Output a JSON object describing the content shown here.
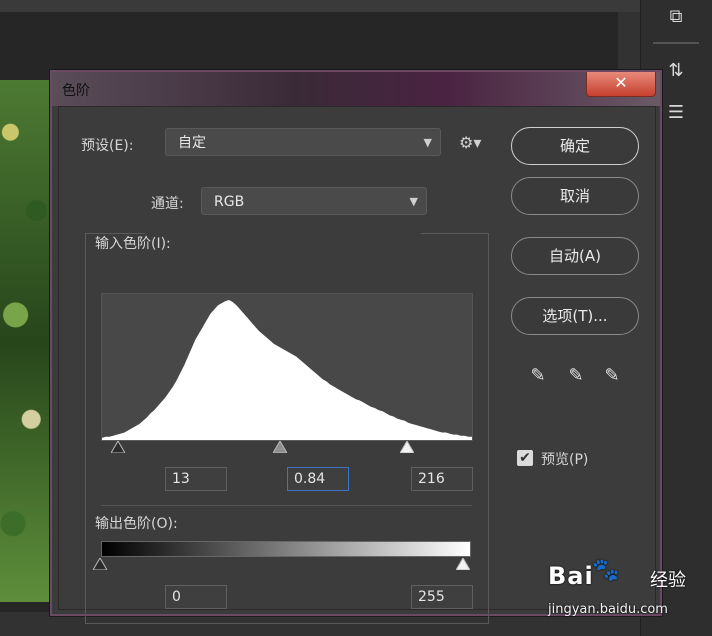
{
  "dialog": {
    "title": "色阶",
    "close_glyph": "✕"
  },
  "preset": {
    "label": "预设(E):",
    "value": "自定",
    "gear_icon": "gear-icon"
  },
  "channel": {
    "label": "通道:",
    "value": "RGB"
  },
  "input_levels": {
    "label": "输入色阶(I):",
    "black": "13",
    "gamma": "0.84",
    "white": "216"
  },
  "output_levels": {
    "label": "输出色阶(O):",
    "black": "0",
    "white": "255"
  },
  "buttons": {
    "ok": "确定",
    "cancel": "取消",
    "auto": "自动(A)",
    "options": "选项(T)..."
  },
  "preview": {
    "label": "预览(P)",
    "checked": true,
    "check_glyph": "✔"
  },
  "watermark": {
    "brand": "Bai",
    "paw": "🐾",
    "cn": "经验",
    "url": "jingyan.baidu.com"
  },
  "histogram": [
    2,
    3,
    3,
    4,
    5,
    6,
    7,
    9,
    11,
    13,
    15,
    18,
    21,
    25,
    28,
    32,
    36,
    40,
    45,
    50,
    56,
    63,
    70,
    78,
    86,
    94,
    100,
    106,
    112,
    118,
    122,
    126,
    128,
    130,
    131,
    129,
    126,
    122,
    118,
    114,
    110,
    106,
    102,
    99,
    96,
    93,
    90,
    88,
    86,
    84,
    82,
    80,
    78,
    75,
    72,
    69,
    66,
    63,
    60,
    57,
    55,
    52,
    50,
    48,
    46,
    44,
    42,
    40,
    38,
    37,
    35,
    33,
    31,
    30,
    28,
    27,
    25,
    23,
    22,
    20,
    19,
    18,
    16,
    15,
    14,
    13,
    12,
    11,
    10,
    9,
    8,
    7,
    7,
    6,
    5,
    5,
    4,
    4,
    3,
    3
  ]
}
